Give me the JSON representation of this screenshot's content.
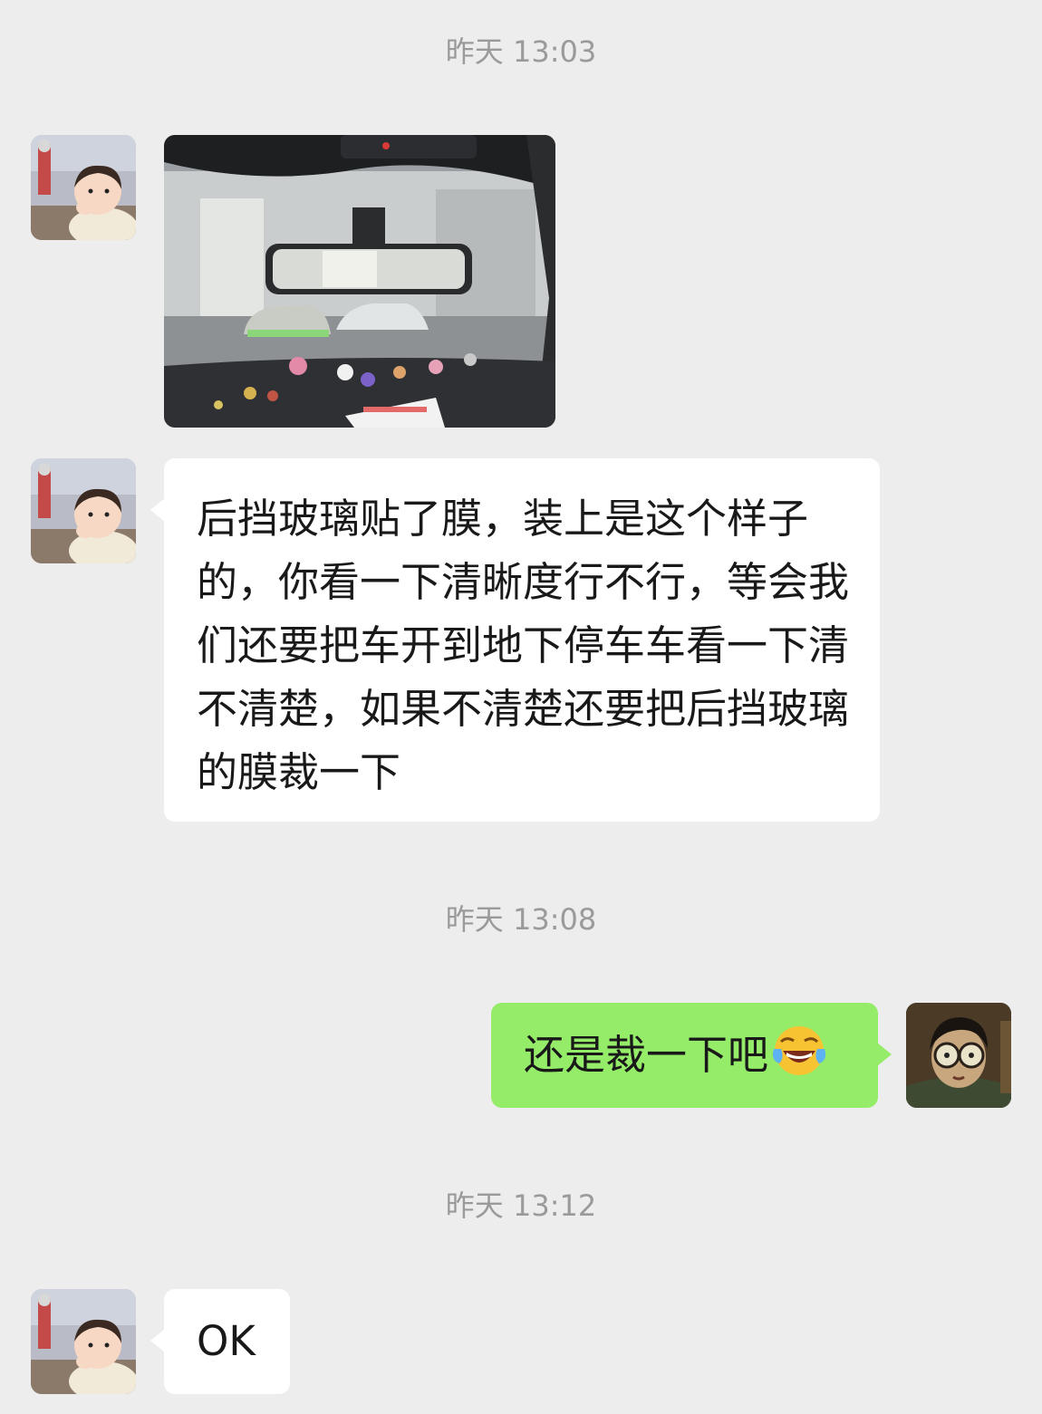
{
  "chat": {
    "timestamps": [
      "昨天 13:03",
      "昨天 13:08",
      "昨天 13:12"
    ],
    "messages": [
      {
        "sender": "contact",
        "type": "image",
        "icon": "car-interior-photo"
      },
      {
        "sender": "contact",
        "type": "text",
        "text": "后挡玻璃贴了膜，装上是这个样子的，你看一下清晰度行不行，等会我们还要把车开到地下停车车看一下清不清楚，如果不清楚还要把后挡玻璃的膜裁一下"
      },
      {
        "sender": "me",
        "type": "text",
        "text": "还是裁一下吧",
        "emoji": "tears-of-joy-emoji"
      },
      {
        "sender": "contact",
        "type": "text",
        "text": "OK"
      }
    ]
  },
  "colors": {
    "background": "#ededed",
    "incoming_bubble": "#ffffff",
    "outgoing_bubble": "#95ec69",
    "timestamp_text": "#9a9a9a"
  }
}
